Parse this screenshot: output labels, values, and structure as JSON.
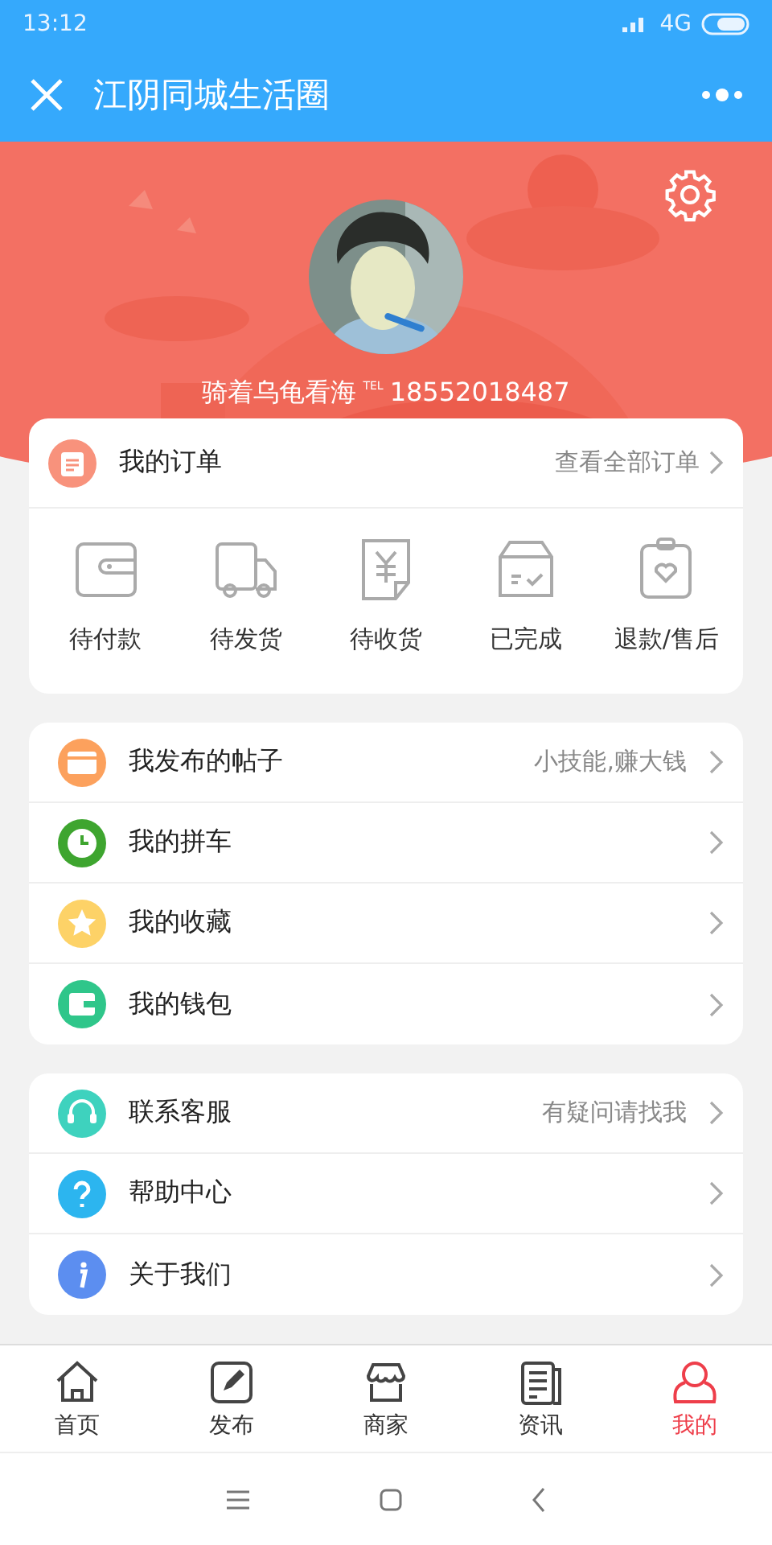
{
  "status_bar": {
    "time": "13:12",
    "network": "4G"
  },
  "header": {
    "title": "江阴同城生活圈"
  },
  "profile": {
    "name": "骑着乌龟看海",
    "tel_label": "TEL",
    "phone": "18552018487"
  },
  "orders": {
    "title": "我的订单",
    "link": "查看全部订单",
    "color": "#f8927c",
    "items": [
      {
        "label": "待付款"
      },
      {
        "label": "待发货"
      },
      {
        "label": "待收货"
      },
      {
        "label": "已完成"
      },
      {
        "label": "退款/售后"
      }
    ]
  },
  "menu_groups": [
    [
      {
        "label": "我发布的帖子",
        "hint": "小技能,赚大钱",
        "color": "#fca15d"
      },
      {
        "label": "我的拼车",
        "color": "#3ea52f"
      },
      {
        "label": "我的收藏",
        "color": "#fdd267"
      },
      {
        "label": "我的钱包",
        "color": "#2fc68a"
      }
    ],
    [
      {
        "label": "联系客服",
        "hint": "有疑问请找我",
        "color": "#3ed2be"
      },
      {
        "label": "帮助中心",
        "color": "#2cb5ef"
      },
      {
        "label": "关于我们",
        "color": "#5c8ef0"
      }
    ]
  ],
  "tabs": [
    {
      "label": "首页",
      "selected": false
    },
    {
      "label": "发布",
      "selected": false
    },
    {
      "label": "商家",
      "selected": false
    },
    {
      "label": "资讯",
      "selected": false
    },
    {
      "label": "我的",
      "selected": true
    }
  ]
}
